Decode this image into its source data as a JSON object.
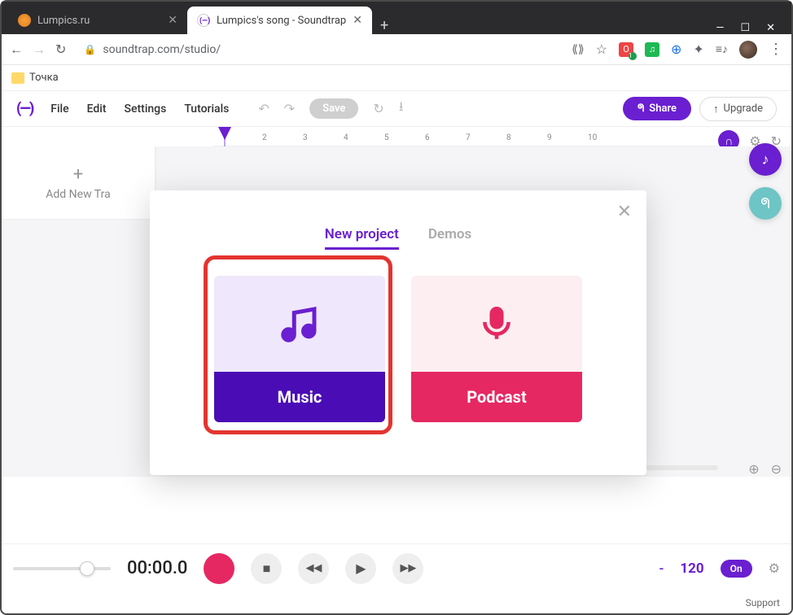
{
  "window": {
    "min": "—",
    "max": "☐",
    "close": "✕"
  },
  "tabs": {
    "inactive": {
      "title": "Lumpics.ru"
    },
    "active": {
      "title": "Lumpics's song - Soundtrap"
    },
    "newtab": "+"
  },
  "address": {
    "back": "←",
    "forward": "→",
    "reload": "↻",
    "url": "soundtrap.com/studio/",
    "translate": "⟪⟫",
    "star": "☆",
    "ext1": "O",
    "ext1_badge": "1",
    "music_ext": "♫",
    "globe": "🌐",
    "puzzle": "✦",
    "menu_ext": "≡♪",
    "dots": "⋮"
  },
  "bookmarks": {
    "folder1": "Точка"
  },
  "app_menu": {
    "logo": "(—)",
    "file": "File",
    "edit": "Edit",
    "settings": "Settings",
    "tutorials": "Tutorials",
    "undo": "↶",
    "redo": "↷",
    "save": "Save",
    "sync": "↻",
    "download": "⭳",
    "share_label": "Share",
    "upgrade_label": "Upgrade",
    "upgrade_icon": "↑"
  },
  "ruler": {
    "marks": [
      "2",
      "3",
      "4",
      "5",
      "6",
      "7",
      "8",
      "9",
      "10"
    ]
  },
  "ruler_tools": {
    "loop": "∩",
    "gear": "⚙",
    "history": "↻"
  },
  "sidebar": {
    "plus": "+",
    "add_track": "Add New Tra"
  },
  "float": {
    "music": "♪",
    "collab": "ᖗ"
  },
  "zoom": {
    "in": "⊕",
    "out": "⊖"
  },
  "modal": {
    "close": "✕",
    "tab_new": "New project",
    "tab_demos": "Demos",
    "music_label": "Music",
    "podcast_label": "Podcast"
  },
  "transport": {
    "time": "00:00.0",
    "stop": "■",
    "rew": "◀◀",
    "play": "▶",
    "ff": "▶▶",
    "key": "-",
    "bpm": "120",
    "on": "On",
    "gear": "⚙"
  },
  "footer": {
    "support": "Support"
  }
}
